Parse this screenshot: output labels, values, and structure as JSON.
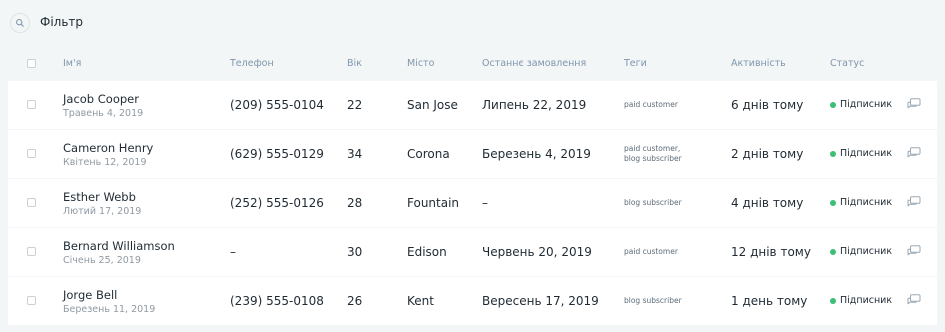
{
  "filter": {
    "label": "Фільтр"
  },
  "columns": {
    "name": "Ім'я",
    "phone": "Телефон",
    "age": "Вік",
    "city": "Місто",
    "last_order": "Останнє замовлення",
    "tags": "Теги",
    "activity": "Активність",
    "status": "Статус"
  },
  "rows": [
    {
      "name": "Jacob Cooper",
      "date": "Травень 4, 2019",
      "phone": "(209) 555-0104",
      "age": "22",
      "city": "San Jose",
      "last_order": "Липень 22, 2019",
      "tags": [
        "paid customer"
      ],
      "activity": "6 днів тому",
      "status": "Підписник"
    },
    {
      "name": "Cameron Henry",
      "date": "Квітень 12, 2019",
      "phone": "(629) 555-0129",
      "age": "34",
      "city": "Corona",
      "last_order": "Березень 4, 2019",
      "tags": [
        "paid customer,",
        "blog subscriber"
      ],
      "activity": "2 днів тому",
      "status": "Підписник"
    },
    {
      "name": "Esther Webb",
      "date": "Лютий 17, 2019",
      "phone": "(252) 555-0126",
      "age": "28",
      "city": "Fountain",
      "last_order": "–",
      "tags": [
        "blog subscriber"
      ],
      "activity": "4 днів тому",
      "status": "Підписник"
    },
    {
      "name": "Bernard Williamson",
      "date": "Січень 25, 2019",
      "phone": "–",
      "age": "30",
      "city": "Edison",
      "last_order": "Червень 20, 2019",
      "tags": [
        "paid customer"
      ],
      "activity": "12 днів тому",
      "status": "Підписник"
    },
    {
      "name": "Jorge Bell",
      "date": "Березень 11, 2019",
      "phone": "(239) 555-0108",
      "age": "26",
      "city": "Kent",
      "last_order": "Вересень 17, 2019",
      "tags": [
        "blog subscriber"
      ],
      "activity": "1 день тому",
      "status": "Підписник"
    }
  ],
  "colors": {
    "background": "#f3f6f6",
    "status_dot": "#3bbf74",
    "header_text": "#7f96ad"
  },
  "icons": {
    "filter": "search-icon",
    "row_action": "chat-icon"
  }
}
